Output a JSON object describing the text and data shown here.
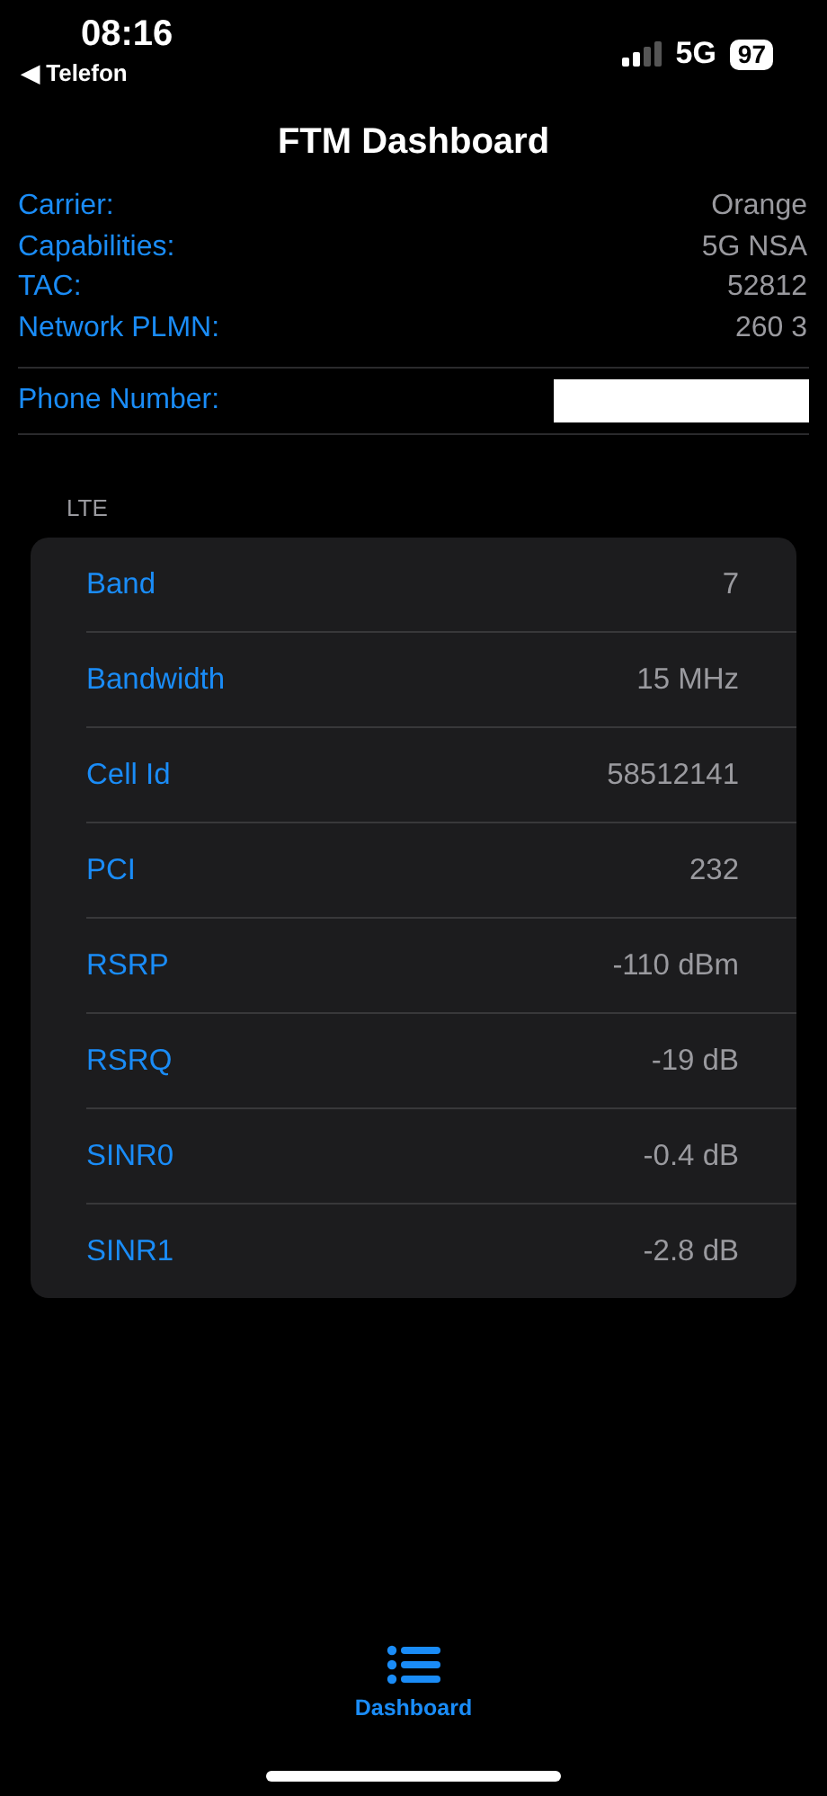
{
  "status_bar": {
    "time": "08:16",
    "back": "◀ Telefon",
    "network": "5G",
    "battery": "97"
  },
  "title": "FTM Dashboard",
  "info": [
    {
      "label": "Carrier:",
      "value": "Orange"
    },
    {
      "label": "Capabilities:",
      "value": "5G NSA"
    },
    {
      "label": "TAC:",
      "value": "52812"
    },
    {
      "label": "Network PLMN:",
      "value": "260 3"
    }
  ],
  "phone": {
    "label": "Phone Number:",
    "redacted": true
  },
  "section": {
    "title": "LTE",
    "rows": [
      {
        "label": "Band",
        "value": "7"
      },
      {
        "label": "Bandwidth",
        "value": "15 MHz"
      },
      {
        "label": "Cell Id",
        "value": "58512141"
      },
      {
        "label": "PCI",
        "value": "232"
      },
      {
        "label": "RSRP",
        "value": "-110 dBm"
      },
      {
        "label": "RSRQ",
        "value": "-19 dB"
      },
      {
        "label": "SINR0",
        "value": "-0.4 dB"
      },
      {
        "label": "SINR1",
        "value": "-2.8 dB"
      }
    ]
  },
  "tab_bar": [
    {
      "label": "Dashboard",
      "selected": true
    }
  ]
}
